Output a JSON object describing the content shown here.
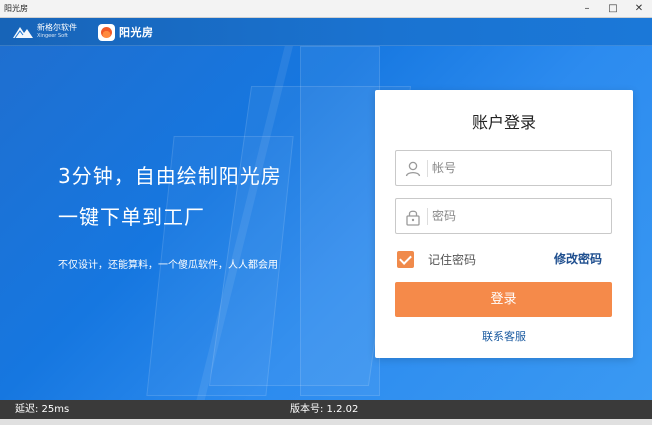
{
  "window": {
    "title": "阳光房",
    "controls": {
      "minimize": "–",
      "maximize": "□",
      "close": "✕"
    }
  },
  "header": {
    "brand_name": "新格尔软件",
    "brand_sub": "Xingeer Soft",
    "product_name": "阳光房"
  },
  "hero": {
    "headline_1": "3分钟，自由绘制阳光房",
    "headline_2": "一键下单到工厂",
    "tagline": "不仅设计，还能算料，一个傻瓜软件，人人都会用"
  },
  "login": {
    "title": "账户登录",
    "username_placeholder": "帐号",
    "password_placeholder": "密码",
    "remember_label": "记住密码",
    "remember_checked": true,
    "change_password_label": "修改密码",
    "login_button": "登录",
    "contact_service": "联系客服",
    "accent_color": "#f58a4a",
    "icons": {
      "user": "user-icon",
      "lock": "lock-icon"
    }
  },
  "status": {
    "latency": "延迟: 25ms",
    "version": "版本号: 1.2.02"
  },
  "colors": {
    "header_blue": "#1a73d1",
    "hero_blue": "#1677e0",
    "statusbar": "#3a3a3a"
  }
}
